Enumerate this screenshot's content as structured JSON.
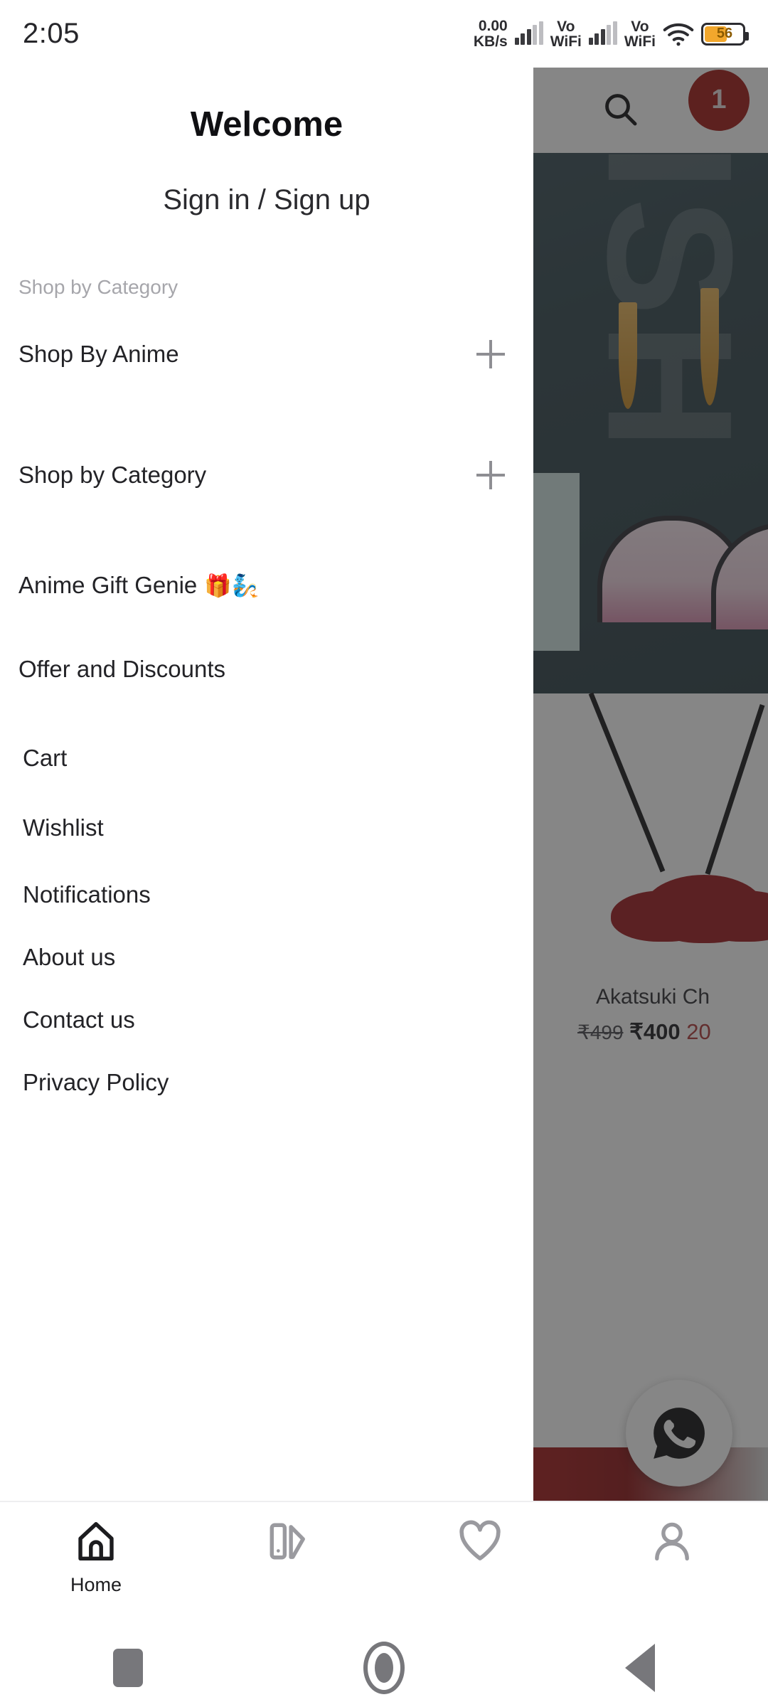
{
  "status_bar": {
    "time": "2:05",
    "net_speed_value": "0.00",
    "net_speed_unit": "KB/s",
    "sim1_label_top": "Vo",
    "sim1_label_bottom": "WiFi",
    "sim2_label_top": "Vo",
    "sim2_label_bottom": "WiFi",
    "wifi_icon": "wifi-icon",
    "battery_percent": "56"
  },
  "drawer": {
    "welcome_title": "Welcome",
    "sign_in_label": "Sign in / Sign up",
    "section_label": "Shop by Category",
    "expandable_items": [
      {
        "label": "Shop By Anime",
        "icon": "plus-icon"
      },
      {
        "label": "Shop by Category",
        "icon": "plus-icon"
      }
    ],
    "primary_links": [
      {
        "label": "Anime Gift Genie",
        "emoji": "🎁🧞"
      },
      {
        "label": "Offer and Discounts",
        "emoji": ""
      }
    ],
    "secondary_links": [
      {
        "label": "Cart"
      },
      {
        "label": "Wishlist"
      },
      {
        "label": "Notifications"
      },
      {
        "label": "About us"
      },
      {
        "label": "Contact us"
      },
      {
        "label": "Privacy Policy"
      }
    ]
  },
  "app_background": {
    "search_icon": "search-icon",
    "cart_icon": "cart-icon",
    "cart_badge_count": "1",
    "banner_text": "WISH",
    "product": {
      "title": "Akatsuki Ch",
      "old_price": "₹499",
      "new_price": "₹400",
      "discount": "20"
    },
    "whatsapp_icon": "whatsapp-icon"
  },
  "bottom_nav": {
    "items": [
      {
        "label": "Home",
        "icon": "home-icon",
        "active": true
      },
      {
        "label": "",
        "icon": "categories-icon",
        "active": false
      },
      {
        "label": "",
        "icon": "heart-icon",
        "active": false
      },
      {
        "label": "",
        "icon": "person-icon",
        "active": false
      }
    ]
  },
  "android_nav": {
    "recents_icon": "recents-square-icon",
    "home_icon": "home-circle-icon",
    "back_icon": "back-triangle-icon"
  },
  "colors": {
    "badge_red": "#a21a16",
    "battery_orange": "#f2a72c",
    "discount_red": "#b03a3a",
    "muted_gray": "#a6a6ab"
  }
}
